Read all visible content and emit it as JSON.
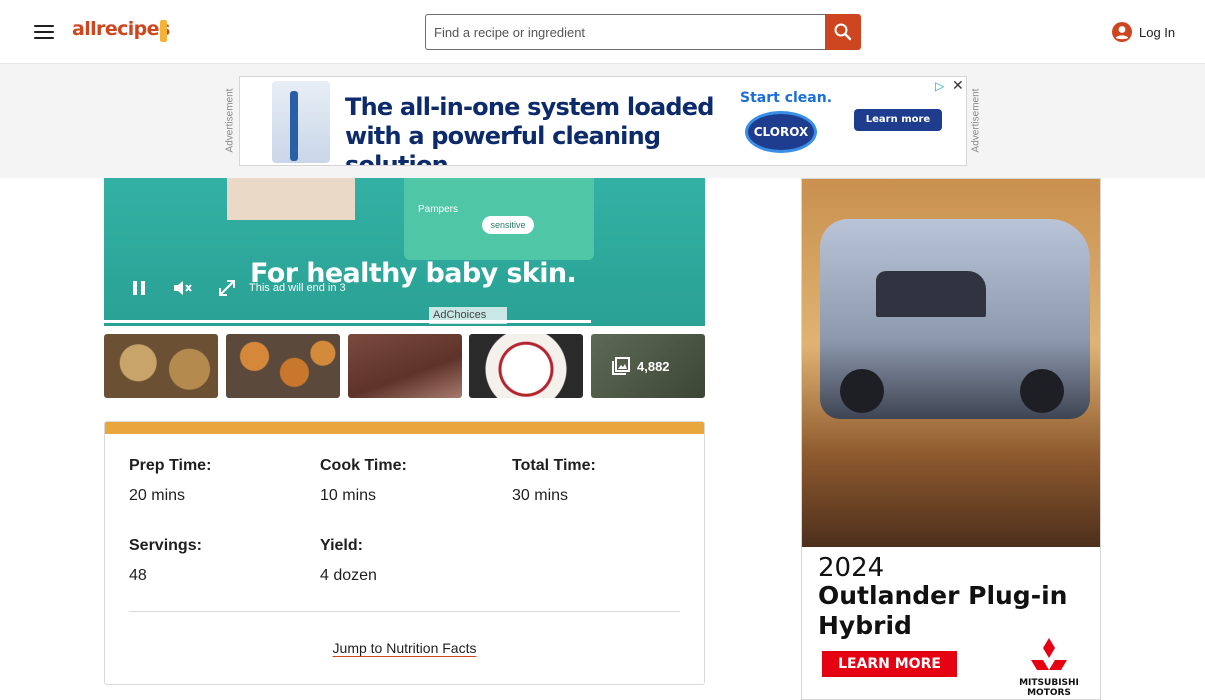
{
  "header": {
    "logo_text": "allrecipes",
    "search_placeholder": "Find a recipe or ingredient",
    "login_label": "Log In"
  },
  "top_ad": {
    "label": "Advertisement",
    "headline": "The all-in-one system loaded with a powerful cleaning solution.",
    "cta_text": "Start clean.",
    "brand": "CLOROX",
    "button_label": "Learn more"
  },
  "video": {
    "slogan": "For healthy baby skin.",
    "ad_countdown": "This ad will end in 3",
    "adchoices": "AdChoices",
    "brand_text": "Pampers",
    "product_text": "sensitive",
    "progress": 0.81
  },
  "gallery": {
    "photo_count": "4,882"
  },
  "recipe_details": {
    "items": [
      {
        "label": "Prep Time:",
        "value": "20 mins"
      },
      {
        "label": "Cook Time:",
        "value": "10 mins"
      },
      {
        "label": "Total Time:",
        "value": "30 mins"
      },
      {
        "label": "Servings:",
        "value": "48"
      },
      {
        "label": "Yield:",
        "value": "4 dozen"
      }
    ],
    "jump_link": "Jump to Nutrition Facts"
  },
  "side_ad": {
    "year": "2024",
    "model": "Outlander Plug-in Hybrid",
    "cta": "LEARN MORE",
    "brand_line1": "MITSUBISHI",
    "brand_line2": "MOTORS"
  },
  "colors": {
    "brand_orange": "#ce4620",
    "accent_gold": "#e9a63c",
    "ad_red": "#e50012"
  }
}
